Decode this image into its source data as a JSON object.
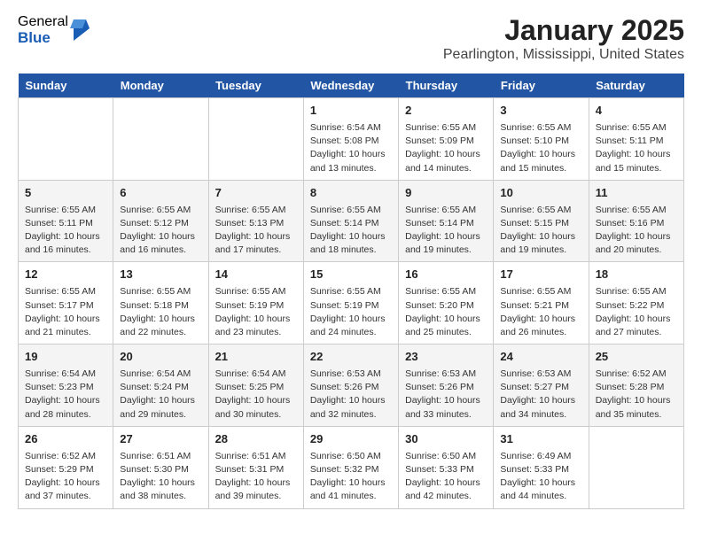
{
  "logo": {
    "general": "General",
    "blue": "Blue"
  },
  "title": "January 2025",
  "location": "Pearlington, Mississippi, United States",
  "weekdays": [
    "Sunday",
    "Monday",
    "Tuesday",
    "Wednesday",
    "Thursday",
    "Friday",
    "Saturday"
  ],
  "weeks": [
    [
      {
        "day": "",
        "info": ""
      },
      {
        "day": "",
        "info": ""
      },
      {
        "day": "",
        "info": ""
      },
      {
        "day": "1",
        "info": "Sunrise: 6:54 AM\nSunset: 5:08 PM\nDaylight: 10 hours\nand 13 minutes."
      },
      {
        "day": "2",
        "info": "Sunrise: 6:55 AM\nSunset: 5:09 PM\nDaylight: 10 hours\nand 14 minutes."
      },
      {
        "day": "3",
        "info": "Sunrise: 6:55 AM\nSunset: 5:10 PM\nDaylight: 10 hours\nand 15 minutes."
      },
      {
        "day": "4",
        "info": "Sunrise: 6:55 AM\nSunset: 5:11 PM\nDaylight: 10 hours\nand 15 minutes."
      }
    ],
    [
      {
        "day": "5",
        "info": "Sunrise: 6:55 AM\nSunset: 5:11 PM\nDaylight: 10 hours\nand 16 minutes."
      },
      {
        "day": "6",
        "info": "Sunrise: 6:55 AM\nSunset: 5:12 PM\nDaylight: 10 hours\nand 16 minutes."
      },
      {
        "day": "7",
        "info": "Sunrise: 6:55 AM\nSunset: 5:13 PM\nDaylight: 10 hours\nand 17 minutes."
      },
      {
        "day": "8",
        "info": "Sunrise: 6:55 AM\nSunset: 5:14 PM\nDaylight: 10 hours\nand 18 minutes."
      },
      {
        "day": "9",
        "info": "Sunrise: 6:55 AM\nSunset: 5:14 PM\nDaylight: 10 hours\nand 19 minutes."
      },
      {
        "day": "10",
        "info": "Sunrise: 6:55 AM\nSunset: 5:15 PM\nDaylight: 10 hours\nand 19 minutes."
      },
      {
        "day": "11",
        "info": "Sunrise: 6:55 AM\nSunset: 5:16 PM\nDaylight: 10 hours\nand 20 minutes."
      }
    ],
    [
      {
        "day": "12",
        "info": "Sunrise: 6:55 AM\nSunset: 5:17 PM\nDaylight: 10 hours\nand 21 minutes."
      },
      {
        "day": "13",
        "info": "Sunrise: 6:55 AM\nSunset: 5:18 PM\nDaylight: 10 hours\nand 22 minutes."
      },
      {
        "day": "14",
        "info": "Sunrise: 6:55 AM\nSunset: 5:19 PM\nDaylight: 10 hours\nand 23 minutes."
      },
      {
        "day": "15",
        "info": "Sunrise: 6:55 AM\nSunset: 5:19 PM\nDaylight: 10 hours\nand 24 minutes."
      },
      {
        "day": "16",
        "info": "Sunrise: 6:55 AM\nSunset: 5:20 PM\nDaylight: 10 hours\nand 25 minutes."
      },
      {
        "day": "17",
        "info": "Sunrise: 6:55 AM\nSunset: 5:21 PM\nDaylight: 10 hours\nand 26 minutes."
      },
      {
        "day": "18",
        "info": "Sunrise: 6:55 AM\nSunset: 5:22 PM\nDaylight: 10 hours\nand 27 minutes."
      }
    ],
    [
      {
        "day": "19",
        "info": "Sunrise: 6:54 AM\nSunset: 5:23 PM\nDaylight: 10 hours\nand 28 minutes."
      },
      {
        "day": "20",
        "info": "Sunrise: 6:54 AM\nSunset: 5:24 PM\nDaylight: 10 hours\nand 29 minutes."
      },
      {
        "day": "21",
        "info": "Sunrise: 6:54 AM\nSunset: 5:25 PM\nDaylight: 10 hours\nand 30 minutes."
      },
      {
        "day": "22",
        "info": "Sunrise: 6:53 AM\nSunset: 5:26 PM\nDaylight: 10 hours\nand 32 minutes."
      },
      {
        "day": "23",
        "info": "Sunrise: 6:53 AM\nSunset: 5:26 PM\nDaylight: 10 hours\nand 33 minutes."
      },
      {
        "day": "24",
        "info": "Sunrise: 6:53 AM\nSunset: 5:27 PM\nDaylight: 10 hours\nand 34 minutes."
      },
      {
        "day": "25",
        "info": "Sunrise: 6:52 AM\nSunset: 5:28 PM\nDaylight: 10 hours\nand 35 minutes."
      }
    ],
    [
      {
        "day": "26",
        "info": "Sunrise: 6:52 AM\nSunset: 5:29 PM\nDaylight: 10 hours\nand 37 minutes."
      },
      {
        "day": "27",
        "info": "Sunrise: 6:51 AM\nSunset: 5:30 PM\nDaylight: 10 hours\nand 38 minutes."
      },
      {
        "day": "28",
        "info": "Sunrise: 6:51 AM\nSunset: 5:31 PM\nDaylight: 10 hours\nand 39 minutes."
      },
      {
        "day": "29",
        "info": "Sunrise: 6:50 AM\nSunset: 5:32 PM\nDaylight: 10 hours\nand 41 minutes."
      },
      {
        "day": "30",
        "info": "Sunrise: 6:50 AM\nSunset: 5:33 PM\nDaylight: 10 hours\nand 42 minutes."
      },
      {
        "day": "31",
        "info": "Sunrise: 6:49 AM\nSunset: 5:33 PM\nDaylight: 10 hours\nand 44 minutes."
      },
      {
        "day": "",
        "info": ""
      }
    ]
  ]
}
